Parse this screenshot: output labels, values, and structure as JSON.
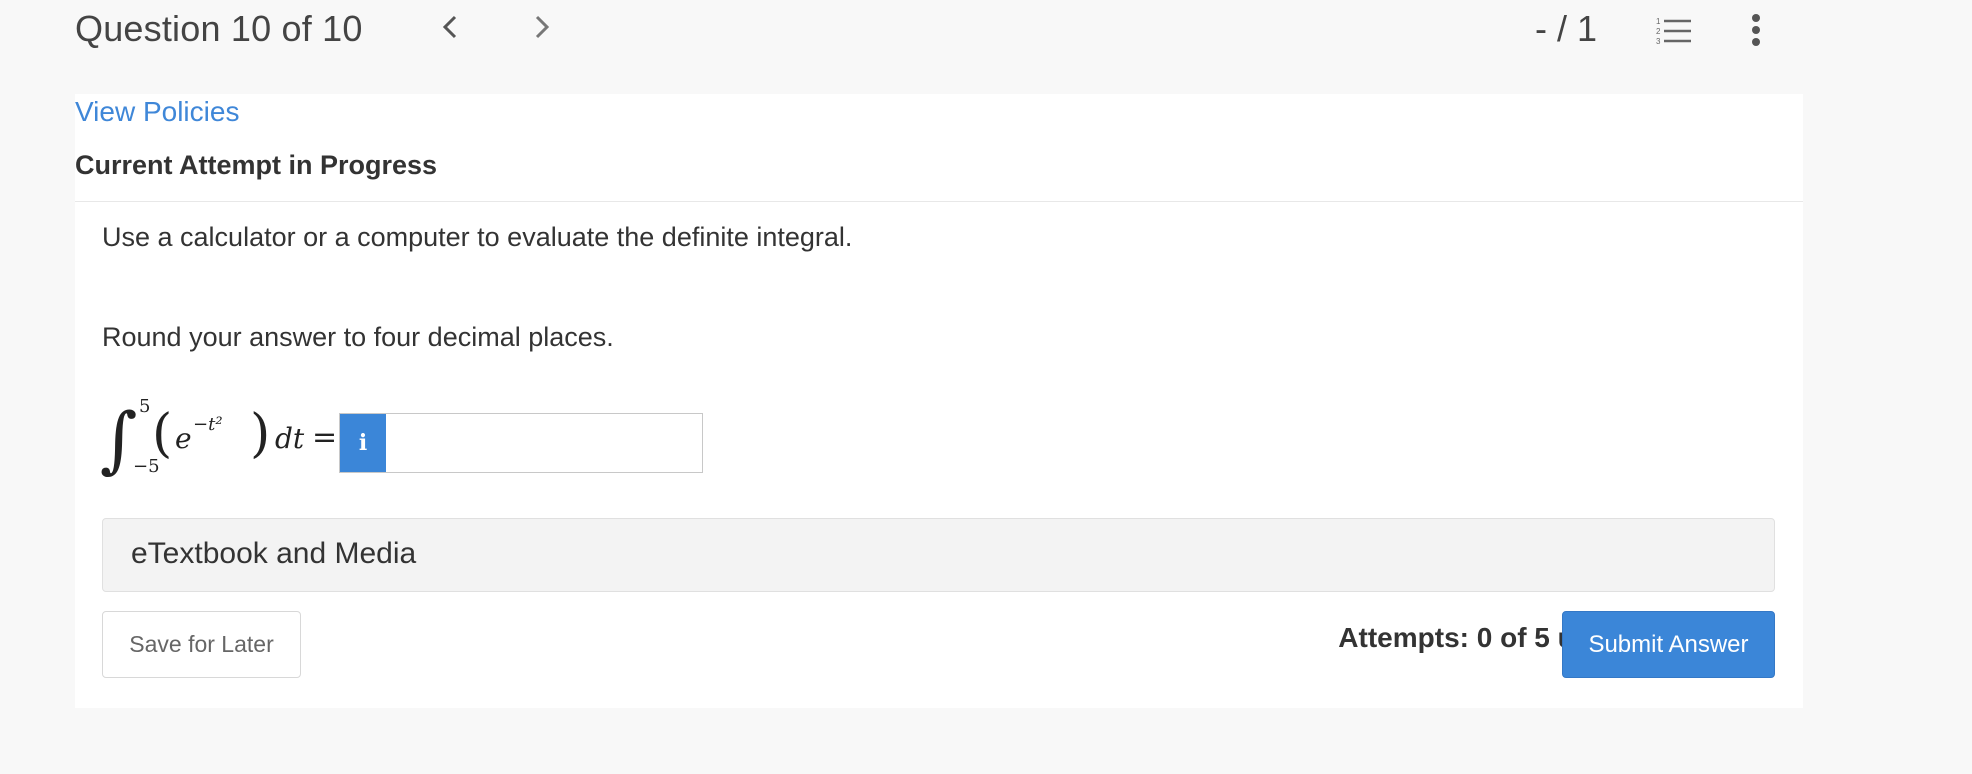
{
  "header": {
    "question_label": "Question 10 of 10",
    "prev_glyph": "‹",
    "next_glyph": "›",
    "score": "- / 1",
    "list_icon": "numbered-list-icon",
    "more_icon": "more-vertical-icon"
  },
  "card": {
    "policies_link": "View Policies",
    "attempt_title": "Current Attempt in Progress",
    "instruction_1": "Use a calculator or a computer to evaluate the definite integral.",
    "instruction_2": "Round your answer to four decimal places.",
    "integral": {
      "integral_sign": "∫",
      "upper_limit": "5",
      "lower_limit": "−5",
      "open_paren": "(",
      "base": "e",
      "exponent": "−t²",
      "close_paren": ")",
      "differential": "dt",
      "equals": "="
    },
    "answer": {
      "info_label": "i",
      "value": ""
    },
    "etextbook_label": "eTextbook and Media",
    "save_label": "Save for Later",
    "attempts_text": "Attempts: 0 of 5 used",
    "submit_label": "Submit Answer"
  },
  "colors": {
    "accent": "#3b86d8",
    "link": "#3f87d8",
    "page_bg": "#f8f8f8"
  }
}
